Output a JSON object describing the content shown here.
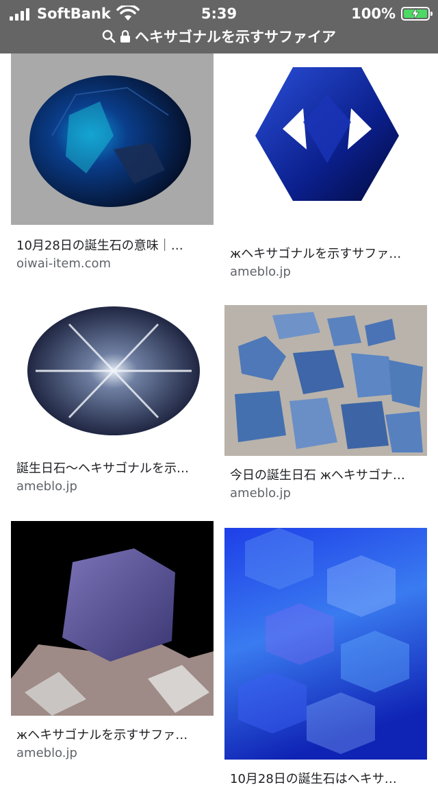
{
  "status_bar": {
    "carrier": "SoftBank",
    "time": "5:39",
    "battery": "100%"
  },
  "url_bar": {
    "query": "ヘキサゴナルを示すサファイア"
  },
  "results": [
    {
      "title": "10月28日の誕生石の意味｜…",
      "domain": "oiwai-item.com",
      "image": "oval-blue-sapphire"
    },
    {
      "title": "жヘキサゴナルを示すサファ…",
      "domain": "ameblo.jp",
      "image": "hexagonal-cut-sapphire"
    },
    {
      "title": "誕生日石〜ヘキサゴナルを示…",
      "domain": "ameblo.jp",
      "image": "star-sapphire-cabochon"
    },
    {
      "title": "今日の誕生日石 жヘキサゴナ…",
      "domain": "ameblo.jp",
      "image": "rough-sapphire-crystals"
    },
    {
      "title": "жヘキサゴナルを示すサファ…",
      "domain": "ameblo.jp",
      "image": "hexagonal-sapphire-crystal-on-matrix"
    },
    {
      "title": "10月28日の誕生石はヘキサ…",
      "domain": "",
      "image": "blue-hexagon-pattern"
    }
  ]
}
